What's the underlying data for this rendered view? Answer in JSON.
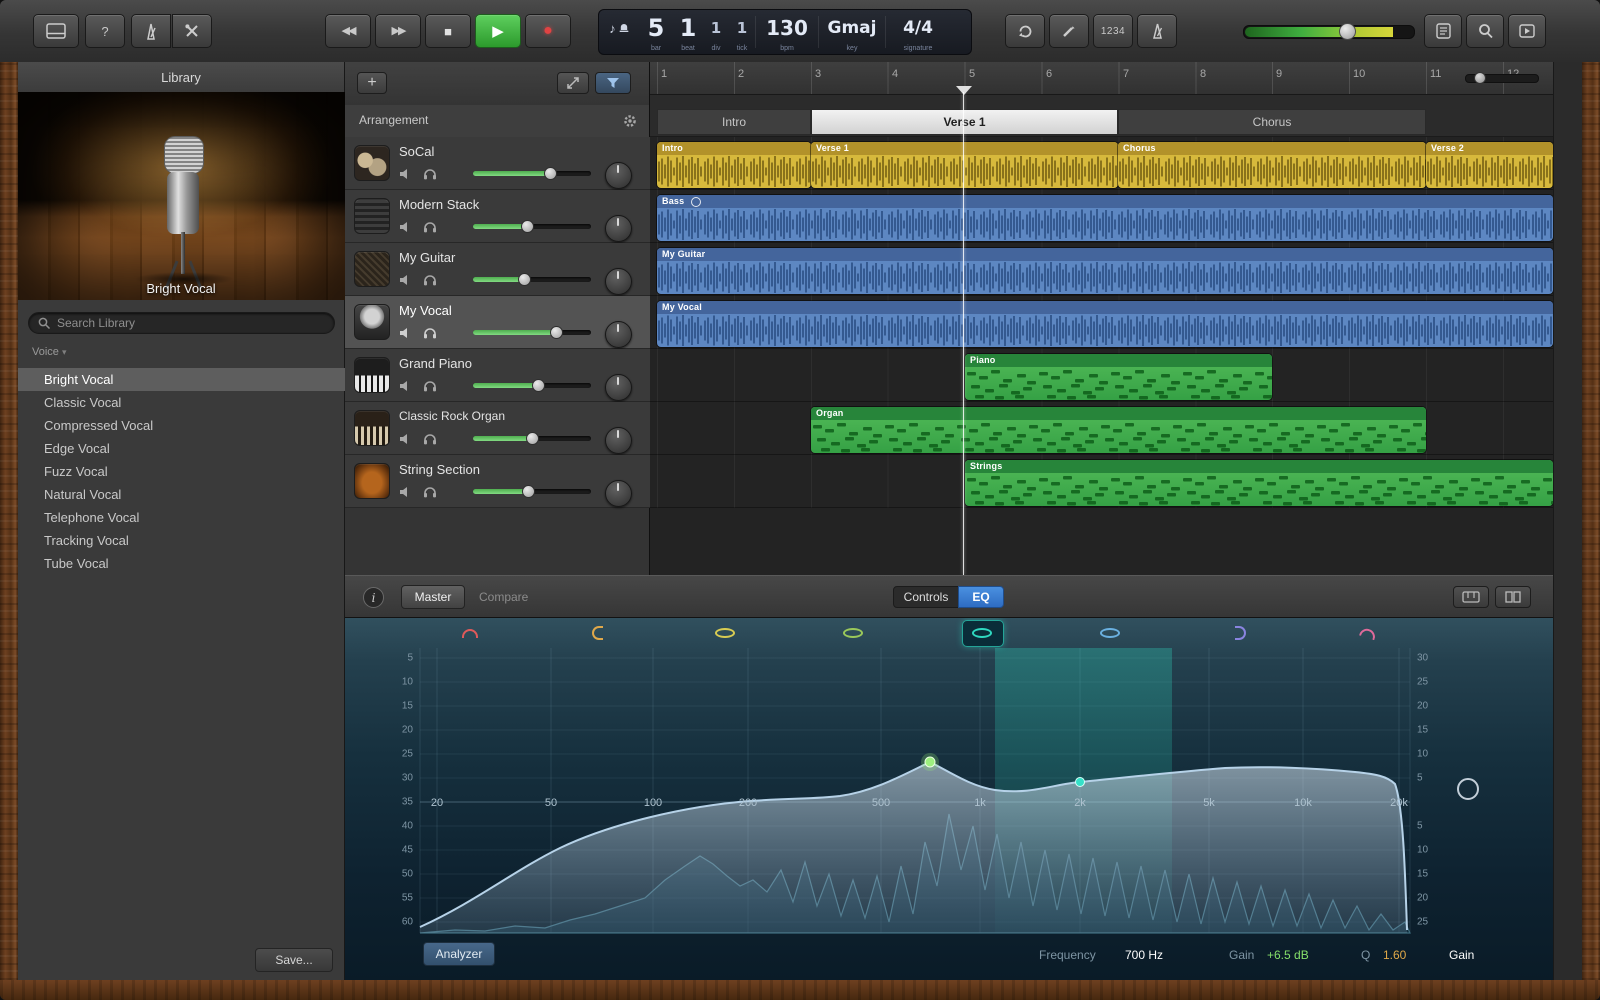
{
  "icons": {
    "rewind": "◀◀",
    "forward": "▶▶",
    "stop": "■",
    "play": "▶",
    "record": "●",
    "help": "?",
    "add": "+",
    "note": "♪",
    "caret_down": "▾"
  },
  "toolbar": {
    "lcd": {
      "bar": "5",
      "beat": "1",
      "div": "1",
      "tick": "1",
      "bar_label": "bar",
      "beat_label": "beat",
      "div_label": "div",
      "tick_label": "tick",
      "tempo": "130",
      "tempo_label": "bpm",
      "key": "Gmaj",
      "key_label": "key",
      "signature": "4/4",
      "signature_label": "signature"
    },
    "count_in_label": "1234"
  },
  "library": {
    "title": "Library",
    "patch_name": "Bright Vocal",
    "search_placeholder": "Search Library",
    "category": "Voice",
    "items": [
      "Bright Vocal",
      "Classic Vocal",
      "Compressed Vocal",
      "Edge Vocal",
      "Fuzz Vocal",
      "Natural Vocal",
      "Telephone Vocal",
      "Tracking Vocal",
      "Tube Vocal"
    ],
    "save_button": "Save..."
  },
  "track_header": {
    "arrangement_label": "Arrangement",
    "tracks": [
      {
        "name": "SoCal"
      },
      {
        "name": "Modern Stack"
      },
      {
        "name": "My Guitar"
      },
      {
        "name": "My Vocal"
      },
      {
        "name": "Grand Piano"
      },
      {
        "name": "Classic Rock Organ"
      },
      {
        "name": "String Section"
      }
    ]
  },
  "timeline": {
    "bars": [
      "1",
      "2",
      "3",
      "4",
      "5",
      "6",
      "7",
      "8",
      "9",
      "10",
      "11",
      "12"
    ],
    "markers": {
      "intro": "Intro",
      "verse1": "Verse 1",
      "chorus": "Chorus"
    },
    "regions": {
      "socal": [
        "Intro",
        "Verse 1",
        "Chorus",
        "Verse 2"
      ],
      "bass": "Bass",
      "guitar": "My Guitar",
      "vocal": "My Vocal",
      "piano": "Piano",
      "organ": "Organ",
      "strings": "Strings"
    }
  },
  "smart_controls": {
    "master_tab": "Master",
    "compare_tab": "Compare",
    "controls_tab": "Controls",
    "eq_tab": "EQ",
    "eq": {
      "freq_labels": [
        "20",
        "50",
        "100",
        "200",
        "500",
        "1k",
        "2k",
        "5k",
        "10k",
        "20k"
      ],
      "db_left": [
        "5",
        "10",
        "15",
        "20",
        "25",
        "30",
        "35",
        "40",
        "45",
        "50",
        "55",
        "60"
      ],
      "db_right": [
        "30",
        "25",
        "20",
        "15",
        "10",
        "5",
        "5",
        "10",
        "15",
        "20",
        "25",
        "30"
      ],
      "analyzer_button": "Analyzer",
      "frequency_label": "Frequency",
      "frequency_value": "700 Hz",
      "gain_label": "Gain",
      "gain_value": "+6.5 dB",
      "q_label": "Q",
      "q_value": "1.60",
      "output_gain_label": "Gain"
    }
  }
}
